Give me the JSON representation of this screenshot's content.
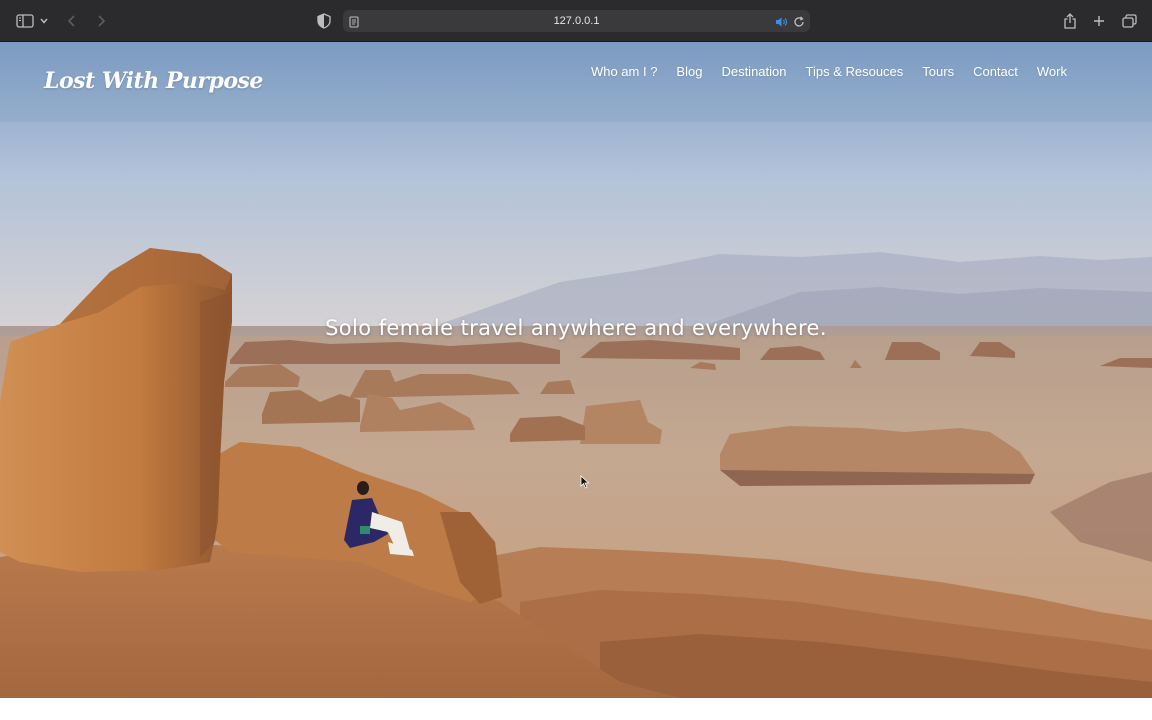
{
  "browser": {
    "url": "127.0.0.1",
    "icons": {
      "sidebar": "sidebar-icon",
      "sidebar_menu": "chevron-down-icon",
      "back": "back-arrow-icon",
      "forward": "forward-arrow-icon",
      "privacy": "shield-icon",
      "page": "page-icon",
      "audio": "speaker-icon",
      "reload": "reload-icon",
      "share": "share-icon",
      "new_tab": "plus-icon",
      "tabs": "tabs-overview-icon"
    }
  },
  "site": {
    "logo": "Lost With Purpose",
    "nav": [
      "Who am I ?",
      "Blog",
      "Destination",
      "Tips & Resouces",
      "Tours",
      "Contact",
      "Work"
    ],
    "tagline": "Solo female travel anywhere and everywhere."
  },
  "colors": {
    "chrome_bg": "#2b2b2d",
    "url_bar": "#3a3a3d",
    "audio_accent": "#3a8ee6",
    "nav_text": "#ffffff"
  }
}
